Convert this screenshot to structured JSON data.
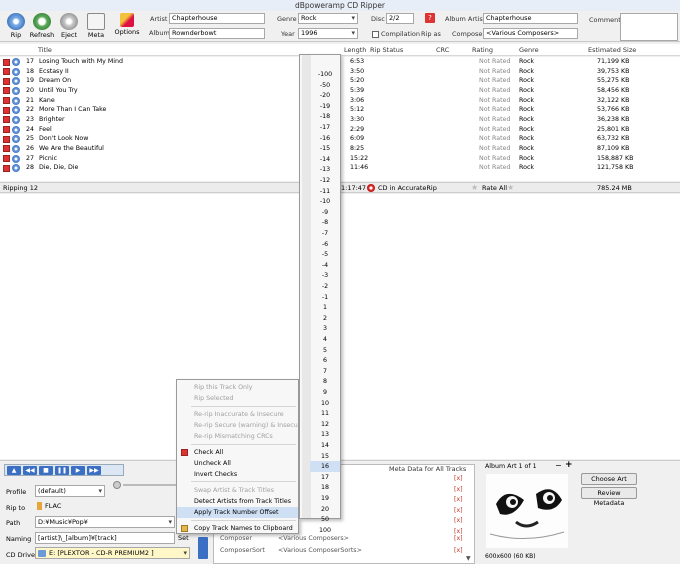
{
  "window": {
    "title": "dBpoweramp CD Ripper"
  },
  "toolbar": {
    "rip": "Rip",
    "refresh": "Refresh",
    "eject": "Eject",
    "meta": "Meta",
    "options": "Options",
    "artist_label": "Artist",
    "artist_value": "Chapterhouse",
    "album_label": "Album",
    "album_value": "Rownderbowt",
    "genre_label": "Genre",
    "genre_value": "Rock",
    "year_label": "Year",
    "year_value": "1996",
    "disc_label": "Disc",
    "disc_value": "2/2",
    "compilation_label": "Compilation",
    "rip_as_label": "Rip as",
    "album_artist_label": "Album Artist",
    "album_artist_value": "Chapterhouse",
    "composer_label": "Composer",
    "composer_value": "<Various Composers>",
    "comment_label": "Comment"
  },
  "columns": {
    "title": "Title",
    "length": "Length",
    "rip_status": "Rip Status",
    "crc": "CRC",
    "rating": "Rating",
    "genre": "Genre",
    "estimated_size": "Estimated Size"
  },
  "tracks": [
    {
      "num": "17",
      "title": "Losing Touch with My Mind",
      "length": "6:53",
      "rating": "Not Rated",
      "genre": "Rock",
      "size": "71,199 KB"
    },
    {
      "num": "18",
      "title": "Ecstasy II",
      "length": "3:50",
      "rating": "Not Rated",
      "genre": "Rock",
      "size": "39,753 KB"
    },
    {
      "num": "19",
      "title": "Dream On",
      "length": "5:20",
      "rating": "Not Rated",
      "genre": "Rock",
      "size": "55,275 KB"
    },
    {
      "num": "20",
      "title": "Until You Try",
      "length": "5:39",
      "rating": "Not Rated",
      "genre": "Rock",
      "size": "58,456 KB"
    },
    {
      "num": "21",
      "title": "Kane",
      "length": "3:06",
      "rating": "Not Rated",
      "genre": "Rock",
      "size": "32,122 KB"
    },
    {
      "num": "22",
      "title": "More Than I Can Take",
      "length": "5:12",
      "rating": "Not Rated",
      "genre": "Rock",
      "size": "53,766 KB"
    },
    {
      "num": "23",
      "title": "Brighter",
      "length": "3:30",
      "rating": "Not Rated",
      "genre": "Rock",
      "size": "36,238 KB"
    },
    {
      "num": "24",
      "title": "Feel",
      "length": "2:29",
      "rating": "Not Rated",
      "genre": "Rock",
      "size": "25,801 KB"
    },
    {
      "num": "25",
      "title": "Don't Look Now",
      "length": "6:09",
      "rating": "Not Rated",
      "genre": "Rock",
      "size": "63,732 KB"
    },
    {
      "num": "26",
      "title": "We Are the Beautiful",
      "length": "8:25",
      "rating": "Not Rated",
      "genre": "Rock",
      "size": "87,109 KB"
    },
    {
      "num": "27",
      "title": "Picnic",
      "length": "15:22",
      "rating": "Not Rated",
      "genre": "Rock",
      "size": "158,887 KB"
    },
    {
      "num": "28",
      "title": "Die, Die, Die",
      "length": "11:46",
      "rating": "Not Rated",
      "genre": "Rock",
      "size": "121,758 KB"
    }
  ],
  "summary": {
    "ripping": "Ripping 12",
    "total_length": "1:17:47",
    "accuraterip": "CD in AccurateRip",
    "rate_all": "Rate All",
    "total_size": "785.24 MB"
  },
  "context_menu": {
    "items": [
      {
        "label": "Rip this Track Only",
        "disabled": true
      },
      {
        "label": "Rip Selected",
        "disabled": true
      },
      {
        "label": "Re-rip Inaccurate & Insecure",
        "disabled": true
      },
      {
        "label": "Re-rip Secure (warning) & Insecure",
        "disabled": true
      },
      {
        "label": "Re-rip Mismatching CRCs",
        "disabled": true
      },
      {
        "label": "Check All",
        "disabled": false
      },
      {
        "label": "Uncheck All",
        "disabled": false
      },
      {
        "label": "Invert Checks",
        "disabled": false
      },
      {
        "label": "Swap Artist & Track Titles",
        "disabled": true
      },
      {
        "label": "Detect Artists from Track Titles",
        "disabled": false
      },
      {
        "label": "Apply Track Number Offset",
        "disabled": false
      },
      {
        "label": "Copy Track Names  to Clipboard",
        "disabled": false
      }
    ]
  },
  "offset_menu": {
    "values": [
      "-100",
      "-50",
      "-20",
      "-19",
      "-18",
      "-17",
      "-16",
      "-15",
      "-14",
      "-13",
      "-12",
      "-11",
      "-10",
      "-9",
      "-8",
      "-7",
      "-6",
      "-5",
      "-4",
      "-3",
      "-2",
      "-1",
      "1",
      "2",
      "3",
      "4",
      "5",
      "6",
      "7",
      "8",
      "9",
      "10",
      "11",
      "12",
      "13",
      "14",
      "15",
      "16",
      "17",
      "18",
      "19",
      "20",
      "50",
      "100"
    ],
    "highlighted": "16"
  },
  "bottom": {
    "profile_label": "Profile",
    "profile_value": "(default)",
    "rip_to_label": "Rip to",
    "rip_to_value": "FLAC",
    "path_label": "Path",
    "path_value": "D:¥Music¥Pop¥",
    "naming_label": "Naming",
    "naming_value": "[artist]\\_[album]¥[track]",
    "set_label": "Set",
    "cd_drive_label": "CD Drive",
    "cd_drive_value": "E:   [PLEXTOR  - CD-R   PREMIUM2 ]"
  },
  "meta_panel": {
    "title": "Meta Data for All Tracks",
    "rows": [
      {
        "name": "Composer",
        "value": "<Various Composers>"
      },
      {
        "name": "ComposerSort",
        "value": "<Various ComposerSorts>"
      }
    ],
    "clear_marker": "[x]"
  },
  "album_art": {
    "title": "Album Art 1 of 1",
    "dimensions": "600x600  (60 KB)",
    "choose_art": "Choose Art",
    "review_metadata": "Review Metadata"
  }
}
